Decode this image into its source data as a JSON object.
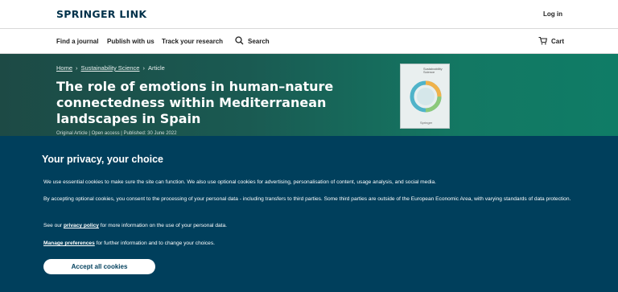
{
  "header": {
    "logo": "SPRINGER LINK",
    "login": "Log in"
  },
  "nav": {
    "find_journal": "Find a journal",
    "publish": "Publish with us",
    "track": "Track your research",
    "search": "Search",
    "cart": "Cart"
  },
  "hero": {
    "breadcrumb": [
      "Home",
      "Sustainability Science",
      "Article"
    ],
    "title": "The role of emotions in human–nature connectedness within Mediterranean landscapes in Spain",
    "meta": "Original Article | Open access | Published: 30 June 2022",
    "cover_title": "Sustainability Science",
    "cover_footer": "Springer"
  },
  "cookie": {
    "title": "Your privacy, your choice",
    "p1": "We use essential cookies to make sure the site can function. We also use optional cookies for advertising, personalisation of content, usage analysis, and social media.",
    "p2": "By accepting optional cookies, you consent to the processing of your personal data - including transfers to third parties. Some third parties are outside of the European Economic Area, with varying standards of data protection.",
    "p3_pre": "See our ",
    "p3_link": "privacy policy",
    "p3_post": " for more information on the use of your personal data.",
    "p4_link": "Manage preferences",
    "p4_post": " for further information and to change your choices.",
    "accept": "Accept all cookies"
  }
}
